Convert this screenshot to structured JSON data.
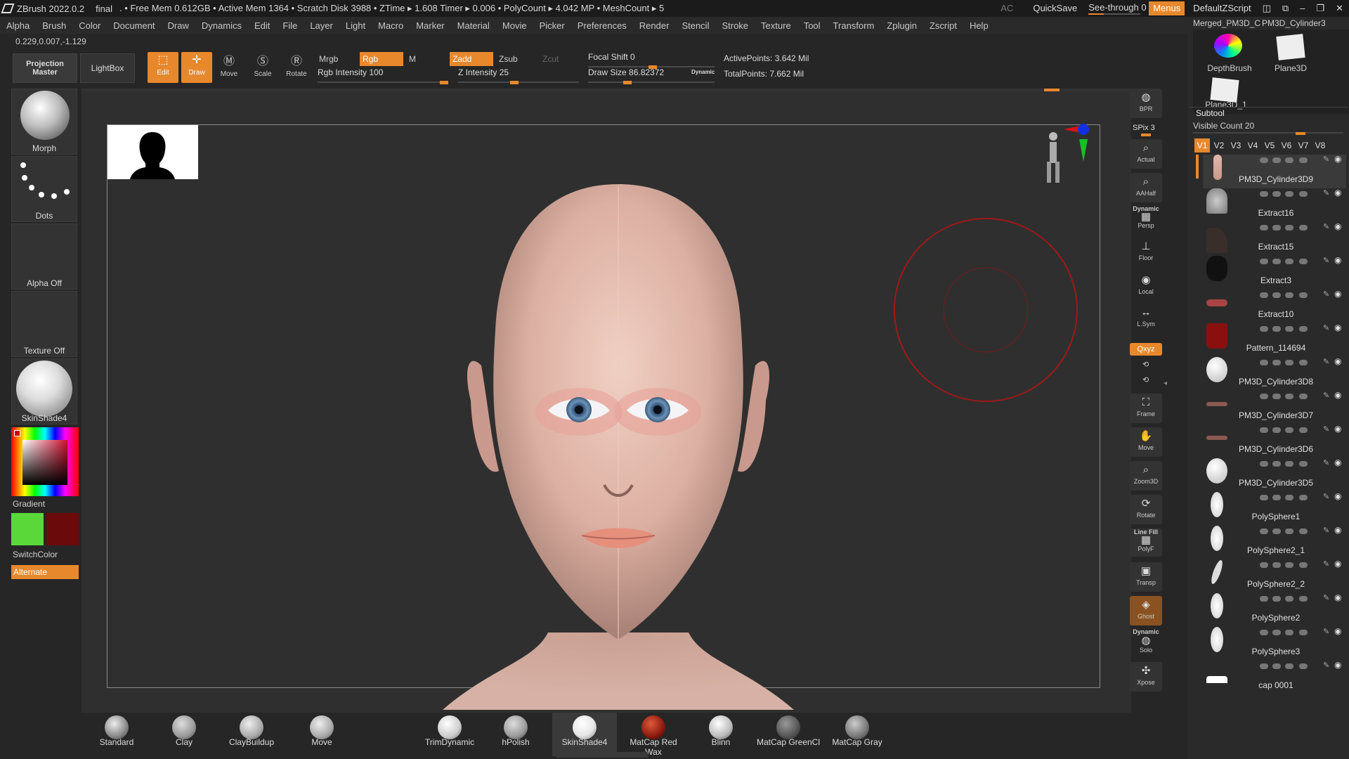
{
  "titlebar": {
    "app": "ZBrush 2022.0.2",
    "doc": "final",
    "stats": ". • Free Mem 0.612GB • Active Mem 1364 • Scratch Disk 3988 • ZTime ▸ 1.608 Timer ▸ 0.006 • PolyCount ▸ 4.042 MP • MeshCount ▸ 5",
    "ac": "AC",
    "quicksave": "QuickSave",
    "seethrough": "See-through",
    "seethrough_value": "0",
    "menus": "Menus",
    "script": "DefaultZScript"
  },
  "menu": [
    "Alpha",
    "Brush",
    "Color",
    "Document",
    "Draw",
    "Dynamics",
    "Edit",
    "File",
    "Layer",
    "Light",
    "Macro",
    "Marker",
    "Material",
    "Movie",
    "Picker",
    "Preferences",
    "Render",
    "Stencil",
    "Stroke",
    "Texture",
    "Tool",
    "Transform",
    "Zplugin",
    "Zscript",
    "Help"
  ],
  "coords": "0.229,0.007,-1.129",
  "toolbar": {
    "projection_master": "Projection Master",
    "lightbox": "LightBox",
    "edit": "Edit",
    "draw": "Draw",
    "move": "Move",
    "scale": "Scale",
    "rotate": "Rotate",
    "mrgb": "Mrgb",
    "rgb": "Rgb",
    "m": "M",
    "rgb_intensity": "Rgb Intensity 100",
    "zadd": "Zadd",
    "zsub": "Zsub",
    "zcut": "Zcut",
    "z_intensity": "Z Intensity 25",
    "focal_shift": "Focal Shift 0",
    "draw_size": "Draw Size 86.82372",
    "dynamic": "Dynamic",
    "active_points": "ActivePoints: 3.642 Mil",
    "total_points": "TotalPoints: 7.662 Mil",
    "rgb_intensity_value": 100,
    "z_intensity_value": 25,
    "focal_shift_value": 0,
    "draw_size_value": 86.82372
  },
  "leftpanel": {
    "morph": "Morph",
    "dots": "Dots",
    "alpha": "Alpha Off",
    "texture": "Texture Off",
    "material": "SkinShade4",
    "gradient": "Gradient",
    "switchcolor": "SwitchColor",
    "alternate": "Alternate",
    "main_color": "#5ad83a",
    "secondary_color": "#6a0a0a"
  },
  "navstrip": {
    "bpr": "BPR",
    "spix": "SPix 3",
    "actual": "Actual",
    "aahalf": "AAHalf",
    "dynamic": "Dynamic",
    "persp": "Persp",
    "floor": "Floor",
    "local": "Local",
    "lsym": "L.Sym",
    "xyz": "Qxyz",
    "frame": "Frame",
    "move": "Move",
    "zoom3d": "Zoom3D",
    "rotate": "Rotate",
    "linefill": "Line Fill",
    "polyf": "PolyF",
    "transp": "Transp",
    "ghost": "Ghost",
    "dynamic2": "Dynamic",
    "solo": "Solo",
    "xpose": "Xpose"
  },
  "tools_top": {
    "merged": "Merged_PM3D_C",
    "cyl": "PM3D_Cylinder3",
    "depthbrush": "DepthBrush",
    "plane": "Plane3D",
    "plane1": "Plane3D_1"
  },
  "subtool": {
    "title": "Subtool",
    "visible_count": "Visible Count 20",
    "visible_count_value": 20,
    "tabs": [
      "V1",
      "V2",
      "V3",
      "V4",
      "V5",
      "V6",
      "V7",
      "V8"
    ],
    "items": [
      "PM3D_Cylinder3D9",
      "Extract16",
      "Extract15",
      "Extract3",
      "Extract10",
      "Pattern_114694",
      "PM3D_Cylinder3D8",
      "PM3D_Cylinder3D7",
      "PM3D_Cylinder3D6",
      "PM3D_Cylinder3D5",
      "PolySphere1",
      "PolySphere2_1",
      "PolySphere2_2",
      "PolySphere2",
      "PolySphere3",
      "cap 0001"
    ]
  },
  "materials": [
    "Standard",
    "Clay",
    "ClayBuildup",
    "Move",
    "TrimDynamic",
    "hPolish",
    "SkinShade4",
    "MatCap Red Wax",
    "Blinn",
    "MatCap GreenCl",
    "MatCap Gray"
  ],
  "colors": {
    "accent": "#e8882c",
    "bg": "#262626"
  }
}
